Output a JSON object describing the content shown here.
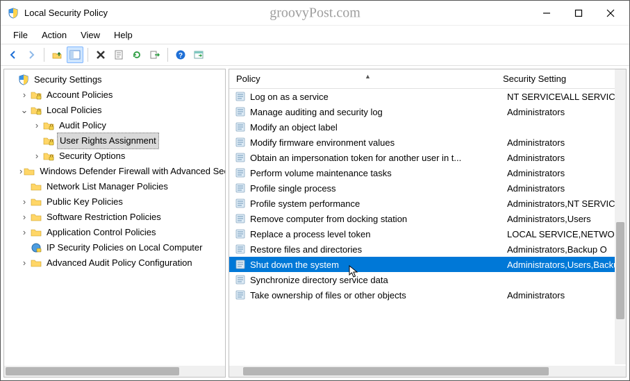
{
  "window": {
    "title": "Local Security Policy",
    "watermark": "groovyPost.com"
  },
  "menu": {
    "items": [
      "File",
      "Action",
      "View",
      "Help"
    ]
  },
  "toolbar": {
    "buttons": [
      {
        "name": "back-icon",
        "active": false
      },
      {
        "name": "forward-icon",
        "active": false
      },
      {
        "name": "sep"
      },
      {
        "name": "up-icon",
        "active": false
      },
      {
        "name": "show-hide-tree-icon",
        "active": true
      },
      {
        "name": "sep"
      },
      {
        "name": "delete-icon",
        "active": false
      },
      {
        "name": "properties-icon",
        "active": false
      },
      {
        "name": "refresh-icon",
        "active": false
      },
      {
        "name": "export-icon",
        "active": false
      },
      {
        "name": "sep"
      },
      {
        "name": "help-icon",
        "active": false
      },
      {
        "name": "action-icon",
        "active": false
      }
    ]
  },
  "tree": {
    "root_label": "Security Settings",
    "nodes": [
      {
        "label": "Account Policies",
        "expander": "›",
        "level": 0,
        "type": "folder-lock"
      },
      {
        "label": "Local Policies",
        "expander": "⌄",
        "level": 0,
        "type": "folder-lock"
      },
      {
        "label": "Audit Policy",
        "expander": "›",
        "level": 1,
        "type": "folder-lock"
      },
      {
        "label": "User Rights Assignment",
        "expander": "",
        "level": 1,
        "type": "folder-lock",
        "selected": true
      },
      {
        "label": "Security Options",
        "expander": "›",
        "level": 1,
        "type": "folder-lock"
      },
      {
        "label": "Windows Defender Firewall with Advanced Security",
        "expander": "›",
        "level": 0,
        "type": "folder"
      },
      {
        "label": "Network List Manager Policies",
        "expander": "",
        "level": 0,
        "type": "folder"
      },
      {
        "label": "Public Key Policies",
        "expander": "›",
        "level": 0,
        "type": "folder"
      },
      {
        "label": "Software Restriction Policies",
        "expander": "›",
        "level": 0,
        "type": "folder"
      },
      {
        "label": "Application Control Policies",
        "expander": "›",
        "level": 0,
        "type": "folder"
      },
      {
        "label": "IP Security Policies on Local Computer",
        "expander": "",
        "level": 0,
        "type": "ipsec"
      },
      {
        "label": "Advanced Audit Policy Configuration",
        "expander": "›",
        "level": 0,
        "type": "folder"
      }
    ]
  },
  "list": {
    "columns": {
      "policy": "Policy",
      "setting": "Security Setting"
    },
    "rows": [
      {
        "policy": "Log on as a service",
        "setting": "NT SERVICE\\ALL SERVICES"
      },
      {
        "policy": "Manage auditing and security log",
        "setting": "Administrators"
      },
      {
        "policy": "Modify an object label",
        "setting": ""
      },
      {
        "policy": "Modify firmware environment values",
        "setting": "Administrators"
      },
      {
        "policy": "Obtain an impersonation token for another user in t...",
        "setting": "Administrators"
      },
      {
        "policy": "Perform volume maintenance tasks",
        "setting": "Administrators"
      },
      {
        "policy": "Profile single process",
        "setting": "Administrators"
      },
      {
        "policy": "Profile system performance",
        "setting": "Administrators,NT SERVICE"
      },
      {
        "policy": "Remove computer from docking station",
        "setting": "Administrators,Users"
      },
      {
        "policy": "Replace a process level token",
        "setting": "LOCAL SERVICE,NETWORK"
      },
      {
        "policy": "Restore files and directories",
        "setting": "Administrators,Backup O"
      },
      {
        "policy": "Shut down the system",
        "setting": "Administrators,Users,Backup",
        "selected": true
      },
      {
        "policy": "Synchronize directory service data",
        "setting": ""
      },
      {
        "policy": "Take ownership of files or other objects",
        "setting": "Administrators"
      }
    ]
  }
}
